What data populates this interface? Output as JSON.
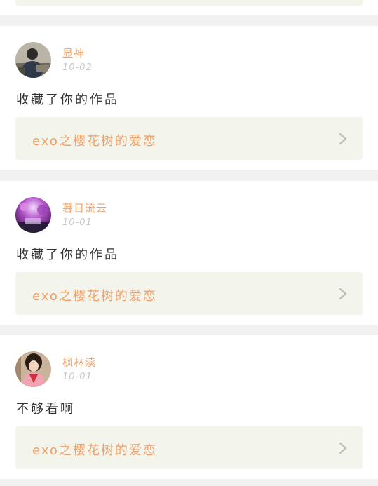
{
  "feed": [
    {
      "username": "显神",
      "date": "10-02",
      "message": "收藏了你的作品",
      "work_title": "exo之樱花树的爱恋"
    },
    {
      "username": "暮日流云",
      "date": "10-01",
      "message": "收藏了你的作品",
      "work_title": "exo之樱花树的爱恋"
    },
    {
      "username": "枫林渎",
      "date": "10-01",
      "message": "不够看啊",
      "work_title": "exo之樱花树的爱恋"
    }
  ],
  "colors": {
    "accent": "#f0a066",
    "link_bg": "#f3f4ec",
    "text": "#333333",
    "muted": "#c8c8c8",
    "divider": "#f1f1f1"
  },
  "icons": {
    "link_arrow": "chevron-right-icon"
  }
}
